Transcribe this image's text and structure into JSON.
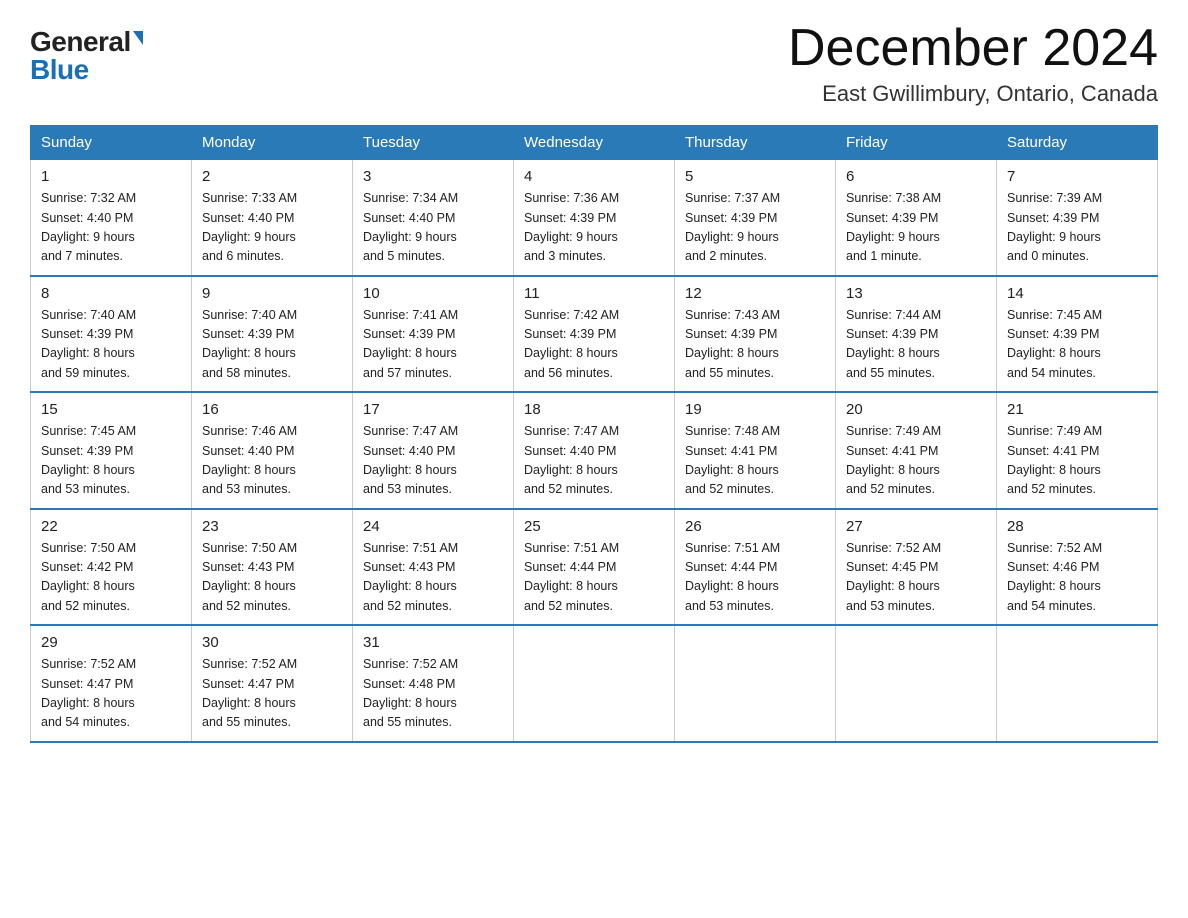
{
  "logo": {
    "general": "General",
    "blue": "Blue"
  },
  "title": "December 2024",
  "location": "East Gwillimbury, Ontario, Canada",
  "days_of_week": [
    "Sunday",
    "Monday",
    "Tuesday",
    "Wednesday",
    "Thursday",
    "Friday",
    "Saturday"
  ],
  "weeks": [
    [
      {
        "day": "1",
        "sunrise": "7:32 AM",
        "sunset": "4:40 PM",
        "daylight": "9 hours and 7 minutes."
      },
      {
        "day": "2",
        "sunrise": "7:33 AM",
        "sunset": "4:40 PM",
        "daylight": "9 hours and 6 minutes."
      },
      {
        "day": "3",
        "sunrise": "7:34 AM",
        "sunset": "4:40 PM",
        "daylight": "9 hours and 5 minutes."
      },
      {
        "day": "4",
        "sunrise": "7:36 AM",
        "sunset": "4:39 PM",
        "daylight": "9 hours and 3 minutes."
      },
      {
        "day": "5",
        "sunrise": "7:37 AM",
        "sunset": "4:39 PM",
        "daylight": "9 hours and 2 minutes."
      },
      {
        "day": "6",
        "sunrise": "7:38 AM",
        "sunset": "4:39 PM",
        "daylight": "9 hours and 1 minute."
      },
      {
        "day": "7",
        "sunrise": "7:39 AM",
        "sunset": "4:39 PM",
        "daylight": "9 hours and 0 minutes."
      }
    ],
    [
      {
        "day": "8",
        "sunrise": "7:40 AM",
        "sunset": "4:39 PM",
        "daylight": "8 hours and 59 minutes."
      },
      {
        "day": "9",
        "sunrise": "7:40 AM",
        "sunset": "4:39 PM",
        "daylight": "8 hours and 58 minutes."
      },
      {
        "day": "10",
        "sunrise": "7:41 AM",
        "sunset": "4:39 PM",
        "daylight": "8 hours and 57 minutes."
      },
      {
        "day": "11",
        "sunrise": "7:42 AM",
        "sunset": "4:39 PM",
        "daylight": "8 hours and 56 minutes."
      },
      {
        "day": "12",
        "sunrise": "7:43 AM",
        "sunset": "4:39 PM",
        "daylight": "8 hours and 55 minutes."
      },
      {
        "day": "13",
        "sunrise": "7:44 AM",
        "sunset": "4:39 PM",
        "daylight": "8 hours and 55 minutes."
      },
      {
        "day": "14",
        "sunrise": "7:45 AM",
        "sunset": "4:39 PM",
        "daylight": "8 hours and 54 minutes."
      }
    ],
    [
      {
        "day": "15",
        "sunrise": "7:45 AM",
        "sunset": "4:39 PM",
        "daylight": "8 hours and 53 minutes."
      },
      {
        "day": "16",
        "sunrise": "7:46 AM",
        "sunset": "4:40 PM",
        "daylight": "8 hours and 53 minutes."
      },
      {
        "day": "17",
        "sunrise": "7:47 AM",
        "sunset": "4:40 PM",
        "daylight": "8 hours and 53 minutes."
      },
      {
        "day": "18",
        "sunrise": "7:47 AM",
        "sunset": "4:40 PM",
        "daylight": "8 hours and 52 minutes."
      },
      {
        "day": "19",
        "sunrise": "7:48 AM",
        "sunset": "4:41 PM",
        "daylight": "8 hours and 52 minutes."
      },
      {
        "day": "20",
        "sunrise": "7:49 AM",
        "sunset": "4:41 PM",
        "daylight": "8 hours and 52 minutes."
      },
      {
        "day": "21",
        "sunrise": "7:49 AM",
        "sunset": "4:41 PM",
        "daylight": "8 hours and 52 minutes."
      }
    ],
    [
      {
        "day": "22",
        "sunrise": "7:50 AM",
        "sunset": "4:42 PM",
        "daylight": "8 hours and 52 minutes."
      },
      {
        "day": "23",
        "sunrise": "7:50 AM",
        "sunset": "4:43 PM",
        "daylight": "8 hours and 52 minutes."
      },
      {
        "day": "24",
        "sunrise": "7:51 AM",
        "sunset": "4:43 PM",
        "daylight": "8 hours and 52 minutes."
      },
      {
        "day": "25",
        "sunrise": "7:51 AM",
        "sunset": "4:44 PM",
        "daylight": "8 hours and 52 minutes."
      },
      {
        "day": "26",
        "sunrise": "7:51 AM",
        "sunset": "4:44 PM",
        "daylight": "8 hours and 53 minutes."
      },
      {
        "day": "27",
        "sunrise": "7:52 AM",
        "sunset": "4:45 PM",
        "daylight": "8 hours and 53 minutes."
      },
      {
        "day": "28",
        "sunrise": "7:52 AM",
        "sunset": "4:46 PM",
        "daylight": "8 hours and 54 minutes."
      }
    ],
    [
      {
        "day": "29",
        "sunrise": "7:52 AM",
        "sunset": "4:47 PM",
        "daylight": "8 hours and 54 minutes."
      },
      {
        "day": "30",
        "sunrise": "7:52 AM",
        "sunset": "4:47 PM",
        "daylight": "8 hours and 55 minutes."
      },
      {
        "day": "31",
        "sunrise": "7:52 AM",
        "sunset": "4:48 PM",
        "daylight": "8 hours and 55 minutes."
      },
      null,
      null,
      null,
      null
    ]
  ],
  "labels": {
    "sunrise": "Sunrise:",
    "sunset": "Sunset:",
    "daylight": "Daylight:"
  }
}
